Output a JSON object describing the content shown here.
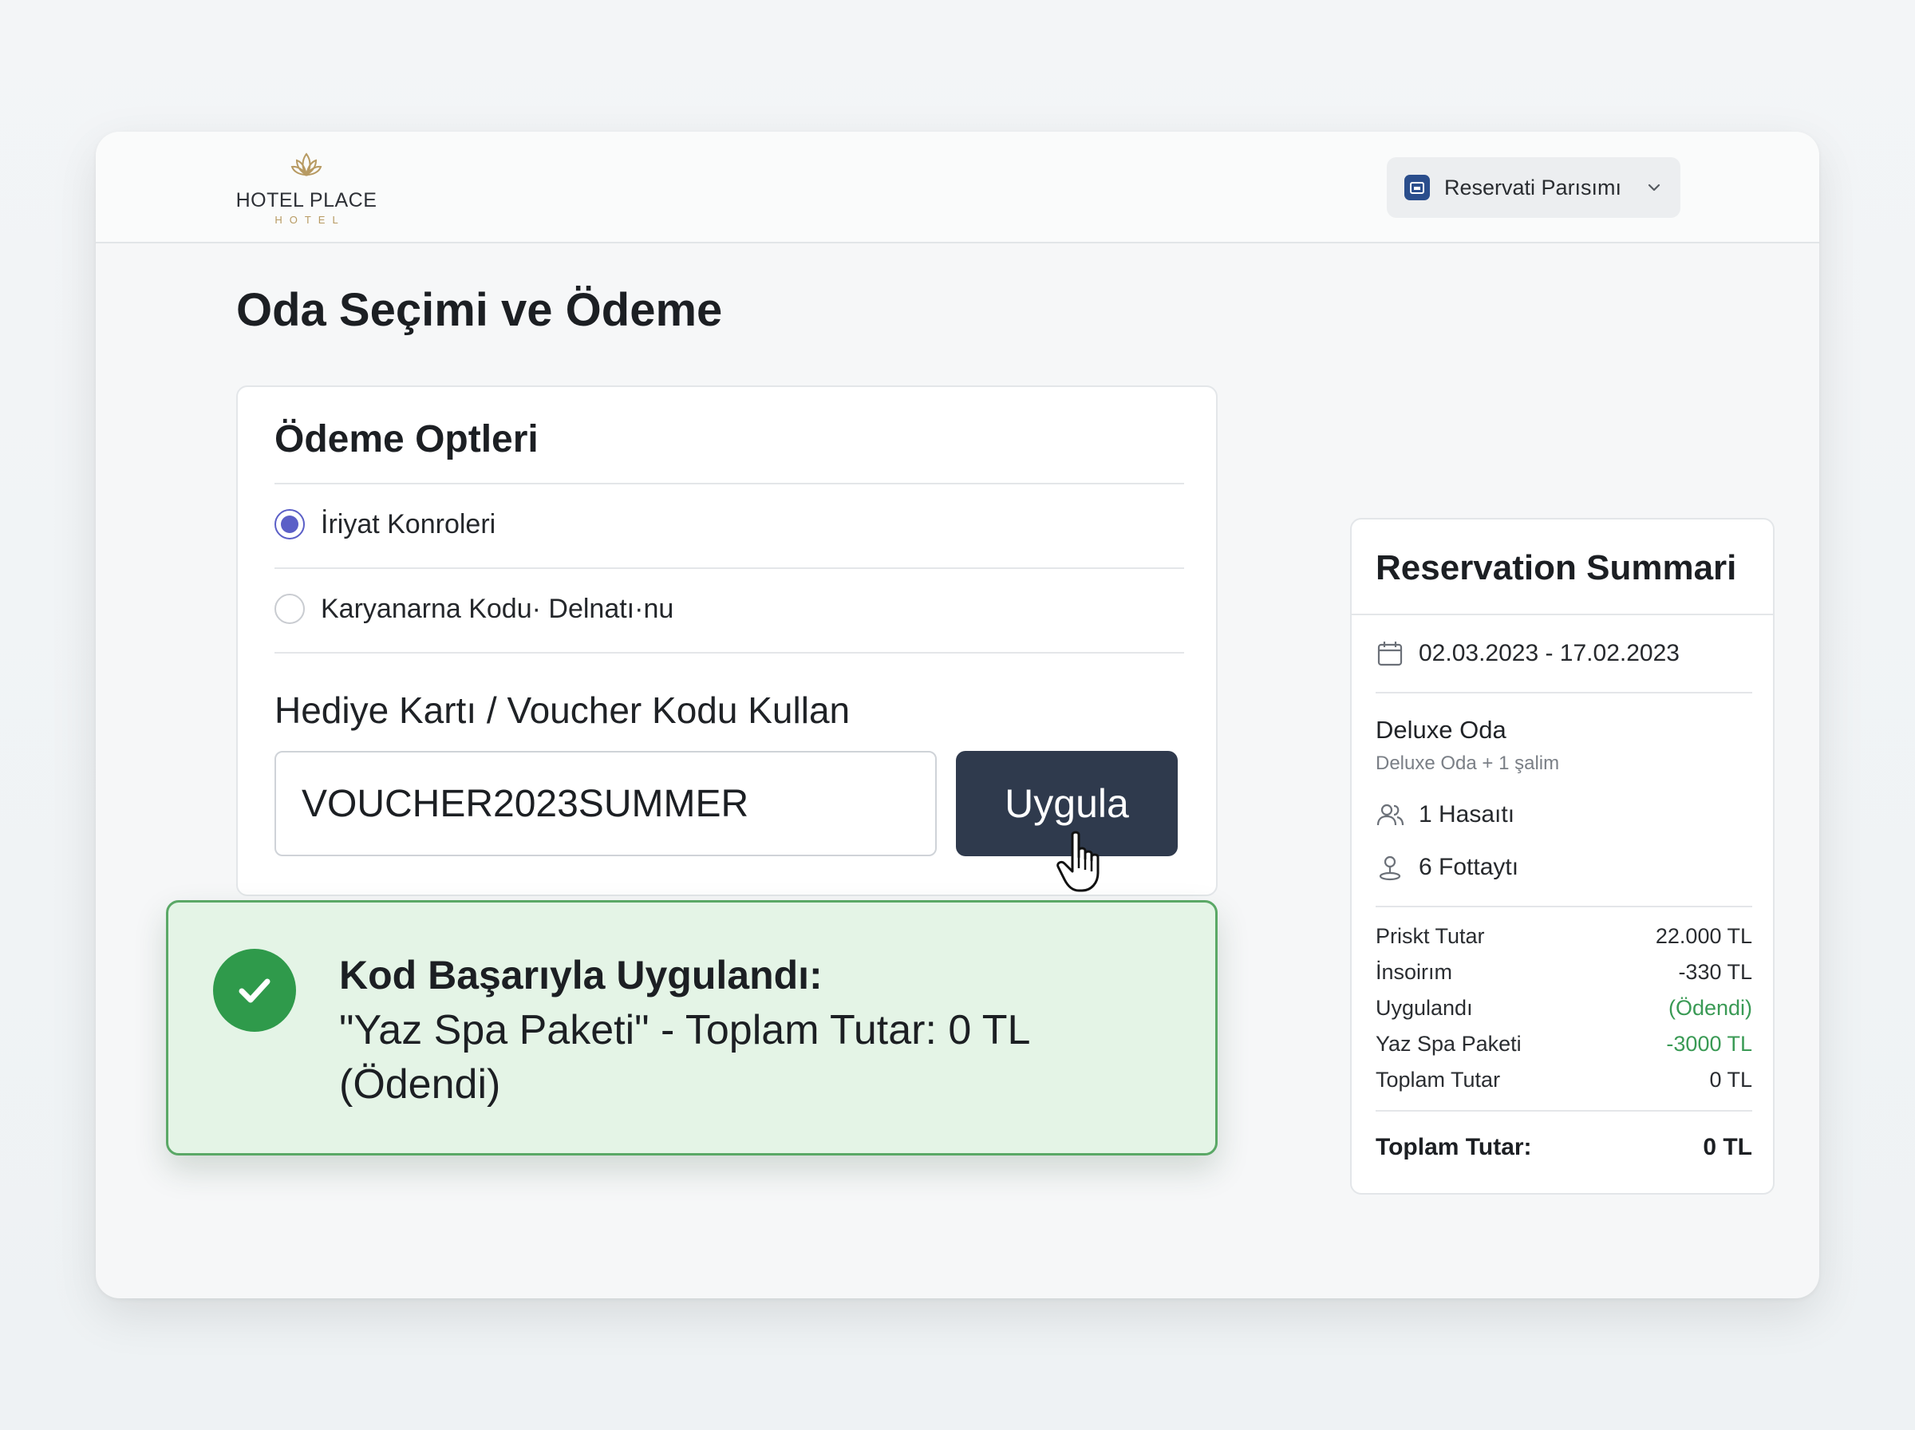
{
  "header": {
    "logo_name": "HOTEL PLACE",
    "logo_sub": "HOTEL",
    "reservation_menu_label": "Reservati Parısımı"
  },
  "page_title": "Oda Seçimi ve Ödeme",
  "payment": {
    "title": "Ödeme Optleri",
    "options": [
      {
        "label": "İriyat Konroleri",
        "selected": true
      },
      {
        "label": "Karyanarna Kodu· Delnatı·nu",
        "selected": false
      }
    ],
    "voucher_label": "Hediye Kartı / Voucher Kodu Kullan",
    "voucher_value": "VOUCHER2023SUMMER",
    "apply_label": "Uygula"
  },
  "toast": {
    "title": "Kod Başarıyla Uygulandı:",
    "body": "\"Yaz Spa Paketi\" - Toplam Tutar: 0 TL (Ödendi)"
  },
  "summary": {
    "title": "Reservation Summari",
    "dates": "02.03.2023 - 17.02.2023",
    "room_name": "Deluxe Oda",
    "room_sub": "Deluxe Oda + 1 şalim",
    "guests": "1 Hasaıtı",
    "extra": "6 Fottaytı",
    "prices": [
      {
        "label": "Priskt Tutar",
        "value": "22.000 TL",
        "green": false
      },
      {
        "label": "İnsoirım",
        "value": "-330 TL",
        "green": false
      },
      {
        "label": "Uygulandı",
        "value": "(Ödendi)",
        "green": true
      },
      {
        "label": "Yaz Spa Paketi",
        "value": "-3000 TL",
        "green": true
      },
      {
        "label": "Toplam Tutar",
        "value": "0 TL",
        "green": false
      }
    ],
    "total_label": "Toplam Tutar:",
    "total_value": "0 TL"
  },
  "colors": {
    "accent_dark": "#2f3a4d",
    "success_green": "#2f9a4b",
    "radio_purple": "#5b5fc7",
    "gold": "#b79a62"
  },
  "icons": [
    "lotus-logo-icon",
    "reservation-icon",
    "chevron-down-icon",
    "calendar-icon",
    "users-icon",
    "person-icon",
    "check-icon",
    "hand-cursor-icon",
    "chat-icon"
  ]
}
